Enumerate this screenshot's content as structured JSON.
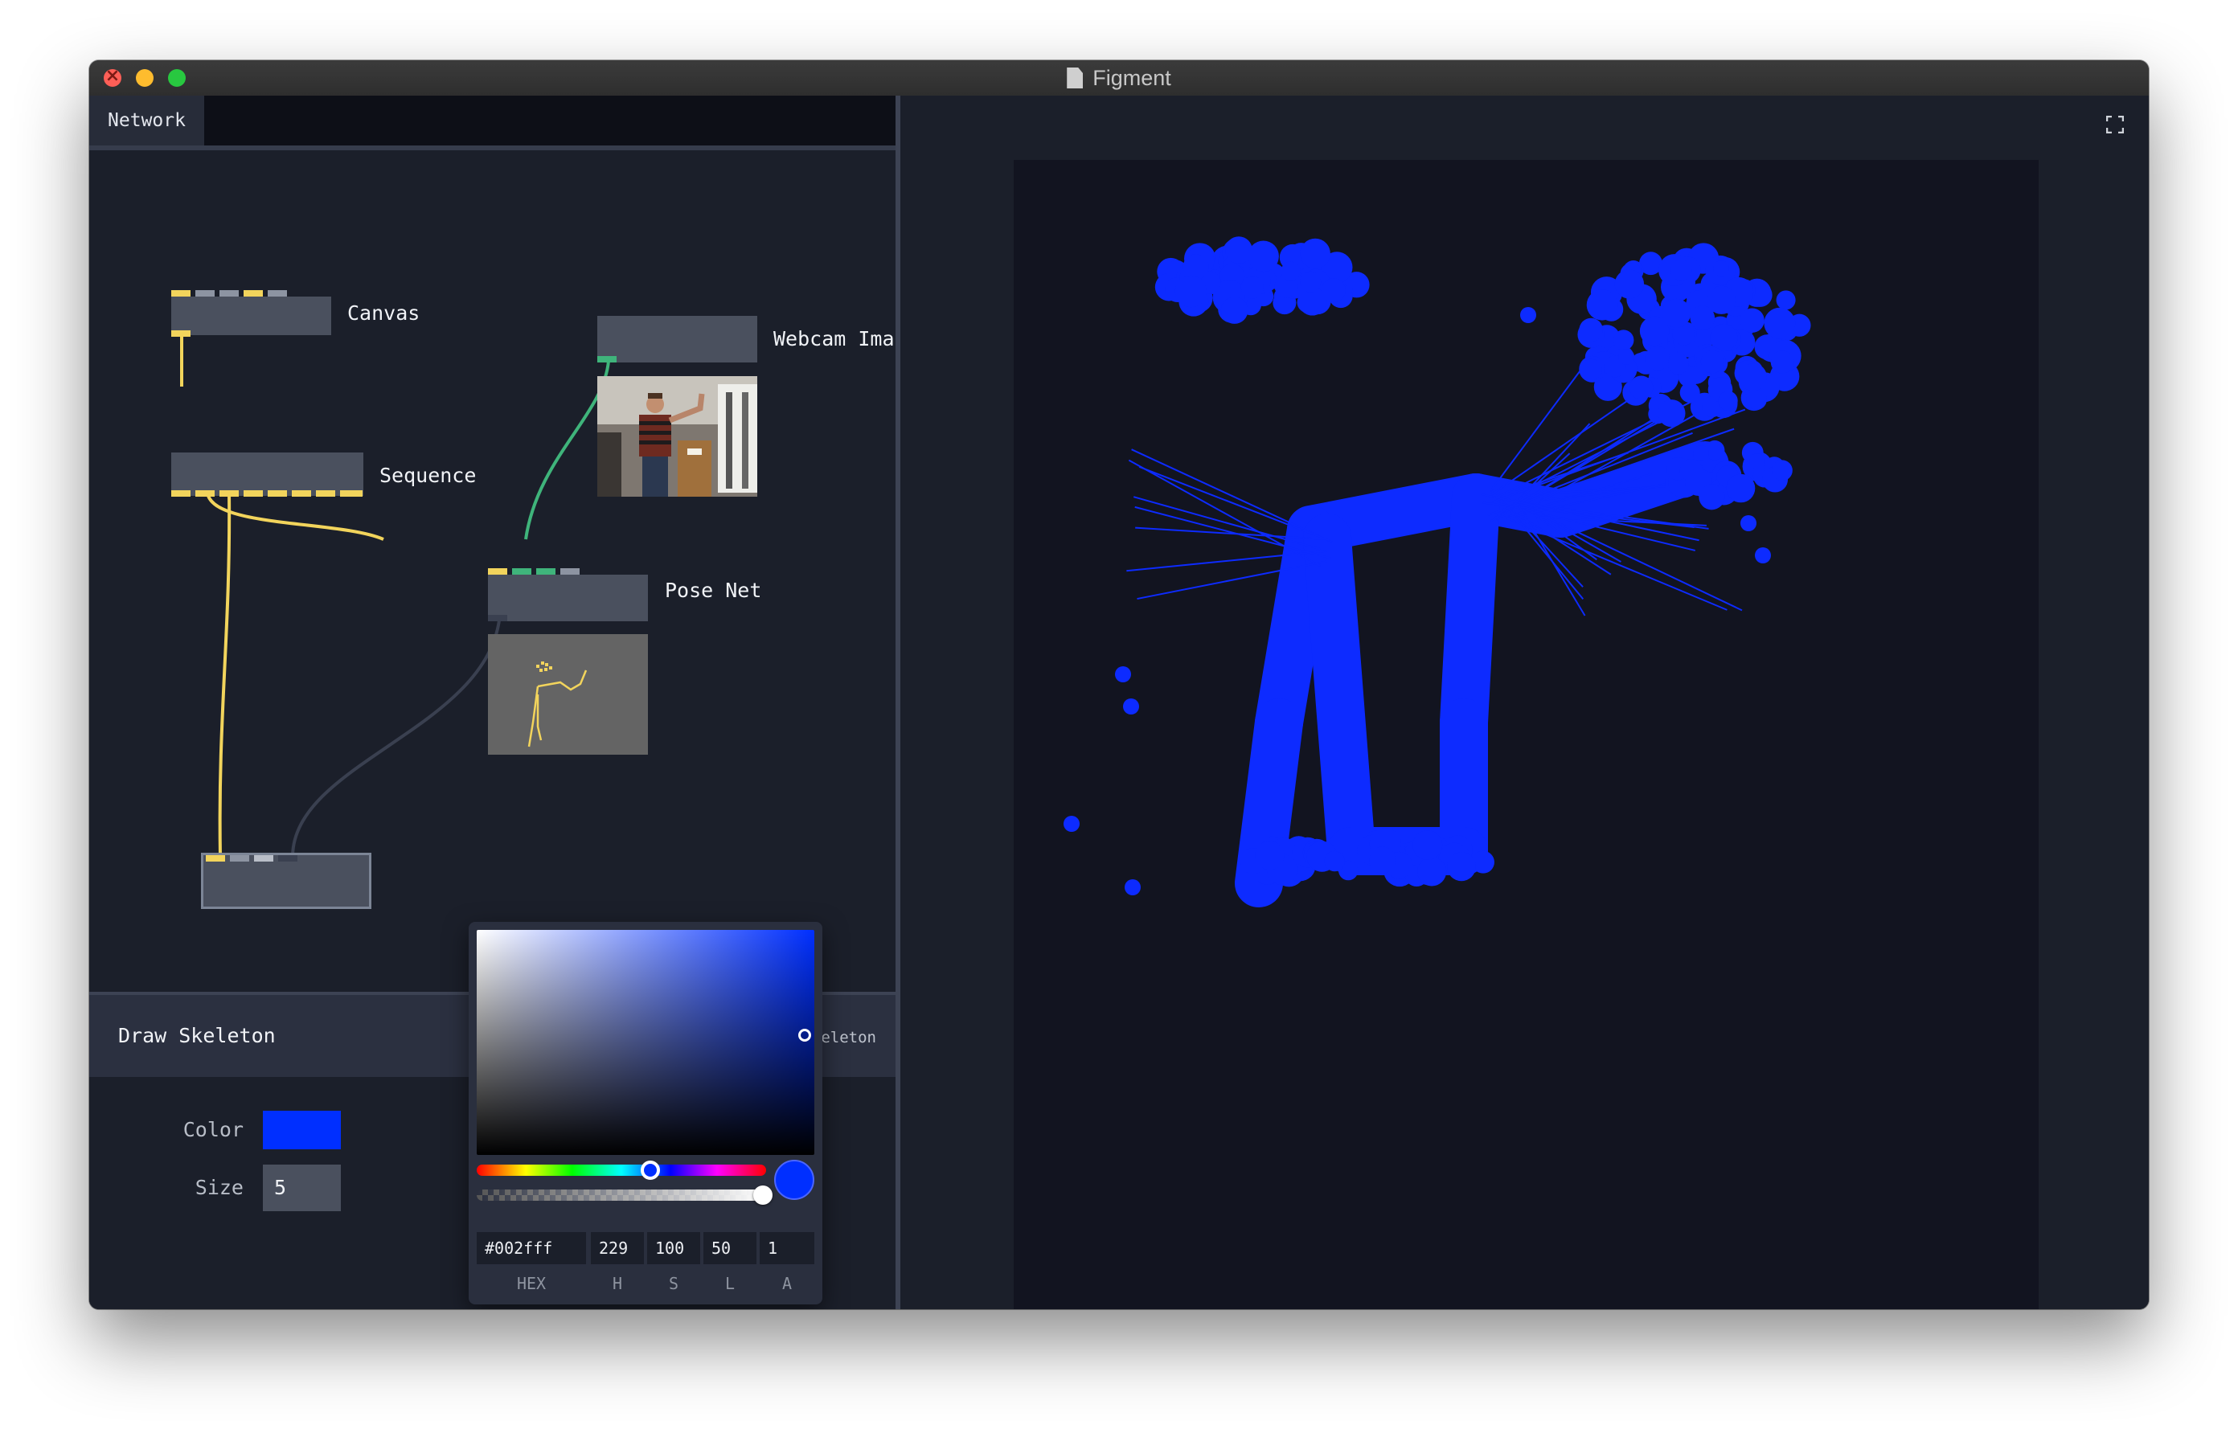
{
  "window": {
    "title": "Figment"
  },
  "tabs": [
    {
      "label": "Network"
    }
  ],
  "nodes": {
    "canvas": {
      "label": "Canvas"
    },
    "sequence": {
      "label": "Sequence"
    },
    "webcam": {
      "label": "Webcam Ima"
    },
    "posenet": {
      "label": "Pose Net"
    }
  },
  "panel": {
    "title": "Draw Skeleton",
    "subtitle": "ect.drawSkeleton",
    "params": {
      "color_label": "Color",
      "color_value": "#002fff",
      "size_label": "Size",
      "size_value": "5"
    }
  },
  "color_picker": {
    "hex": "#002fff",
    "h": "229",
    "s": "100",
    "l": "50",
    "a": "1",
    "labels": {
      "hex": "HEX",
      "h": "H",
      "s": "S",
      "l": "L",
      "a": "A"
    }
  },
  "colors": {
    "skeleton": "#0d2bff",
    "link_yellow": "#f2d45c",
    "link_green": "#3fb47b",
    "link_dark": "#3a4050"
  },
  "icons": [
    "doc-icon",
    "fullscreen-icon",
    "close-icon"
  ]
}
